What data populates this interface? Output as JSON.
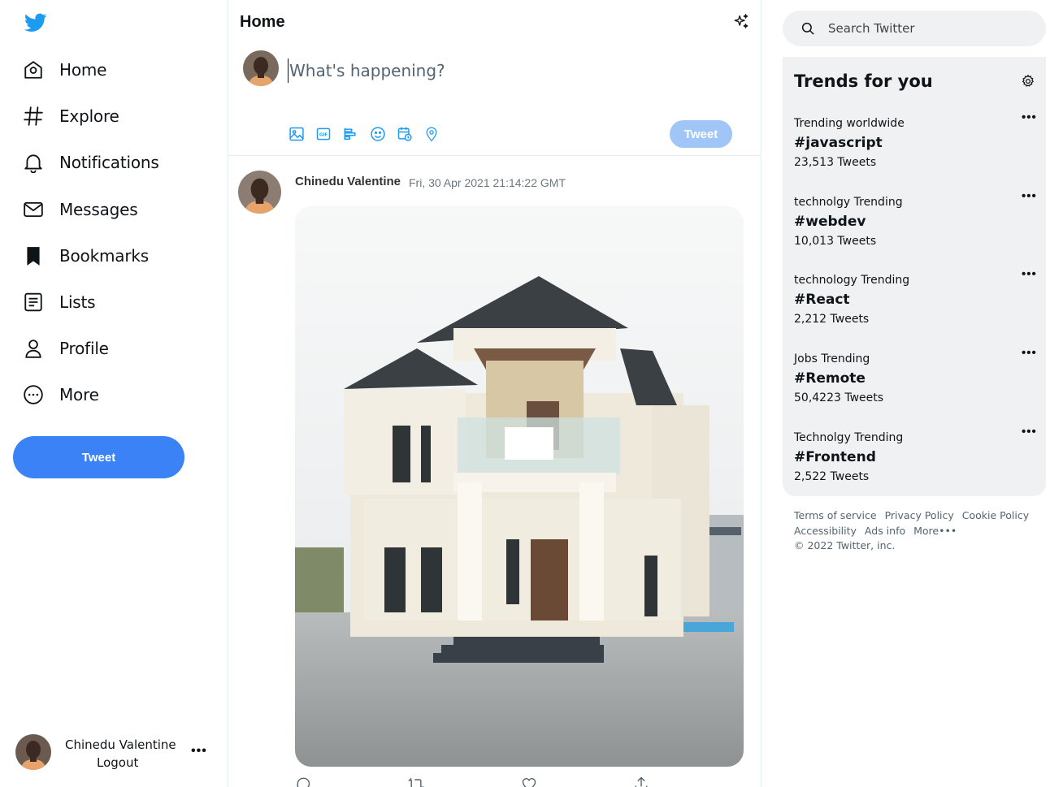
{
  "sidebar": {
    "logo_icon": "twitter-bird-icon",
    "items": [
      {
        "label": "Home",
        "icon": "home-icon"
      },
      {
        "label": "Explore",
        "icon": "hashtag-icon"
      },
      {
        "label": "Notifications",
        "icon": "bell-icon"
      },
      {
        "label": "Messages",
        "icon": "envelope-icon"
      },
      {
        "label": "Bookmarks",
        "icon": "bookmark-icon"
      },
      {
        "label": "Lists",
        "icon": "list-icon"
      },
      {
        "label": "Profile",
        "icon": "person-icon"
      },
      {
        "label": "More",
        "icon": "more-circle-icon"
      }
    ],
    "tweet_label": "Tweet",
    "account": {
      "name": "Chinedu Valentine",
      "logout_label": "Logout",
      "menu": "•••"
    }
  },
  "main": {
    "title": "Home",
    "composer": {
      "placeholder": "What's happening?",
      "tweet_label": "Tweet"
    },
    "post": {
      "author": "Chinedu Valentine",
      "timestamp": "Fri, 30 Apr 2021 21:14:22 GMT"
    }
  },
  "right": {
    "search_placeholder": "Search Twitter",
    "trends_title": "Trends for you",
    "trends": [
      {
        "context": "Trending worldwide",
        "tag": "#javascript",
        "count": "23,513 Tweets"
      },
      {
        "context": "technolgy Trending",
        "tag": "#webdev",
        "count": "10,013 Tweets"
      },
      {
        "context": "technology Trending",
        "tag": "#React",
        "count": "2,212 Tweets"
      },
      {
        "context": "Jobs Trending",
        "tag": "#Remote",
        "count": "50,4223 Tweets"
      },
      {
        "context": "Technolgy Trending",
        "tag": "#Frontend",
        "count": "2,522 Tweets"
      }
    ],
    "trend_menu": "•••",
    "footer": {
      "links": [
        "Terms of service",
        "Privacy Policy",
        "Cookie Policy",
        "Accessibility",
        "Ads info",
        "More•••"
      ],
      "copyright": "© 2022 Twitter, inc."
    }
  },
  "colors": {
    "accent": "#3b82f6",
    "accent_disabled": "#9fc6f7",
    "panel": "#eff1f3",
    "icon_blue": "#1d9bf0"
  }
}
